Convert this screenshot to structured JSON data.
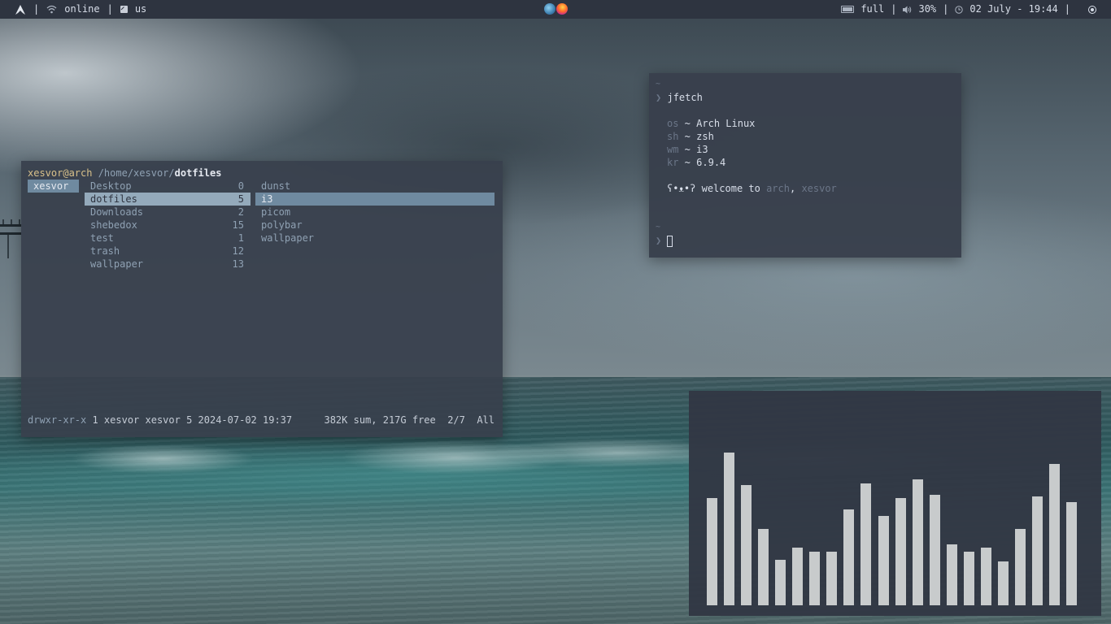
{
  "topbar": {
    "left": {
      "logo_icon": "arch-logo-icon",
      "separator": "|",
      "network_icon": "wifi-icon",
      "network_status": "online",
      "keyboard_icon": "keyboard-icon",
      "keyboard_layout": "us"
    },
    "center": {
      "apps": [
        "globe-app-icon",
        "firefox-app-icon"
      ]
    },
    "right": {
      "battery_icon": "battery-icon",
      "battery_status": "full",
      "volume_icon": "volume-icon",
      "volume_level": "30%",
      "clock_icon": "clock-icon",
      "datetime": "02 July - 19:44",
      "power_icon": "power-icon"
    }
  },
  "file_manager": {
    "header": {
      "user_host": "xesvor@arch",
      "path": " /home/xesvor/",
      "current_dir": "dotfiles"
    },
    "parent_column": [
      {
        "name": "xesvor",
        "selected": true
      }
    ],
    "current_column": [
      {
        "name": "Desktop",
        "count": "0"
      },
      {
        "name": "dotfiles",
        "count": "5",
        "selected": true
      },
      {
        "name": "Downloads",
        "count": "2"
      },
      {
        "name": "shebedox",
        "count": "15"
      },
      {
        "name": "test",
        "count": "1"
      },
      {
        "name": "trash",
        "count": "12"
      },
      {
        "name": "wallpaper",
        "count": "13"
      }
    ],
    "preview_column": [
      {
        "name": "dunst"
      },
      {
        "name": "i3",
        "selected": true
      },
      {
        "name": "picom"
      },
      {
        "name": "polybar"
      },
      {
        "name": "wallpaper"
      }
    ],
    "status": {
      "permissions": "drwxr-xr-x",
      "details": " 1 xesvor xesvor 5 2024-07-02 19:37",
      "summary": "382K sum, 217G free  2/7  All"
    }
  },
  "terminal": {
    "tilde1": "~",
    "prompt_symbol": "❯",
    "command": "jfetch",
    "info": [
      {
        "key": "os",
        "sep": " ~ ",
        "value": "Arch Linux"
      },
      {
        "key": "sh",
        "sep": " ~ ",
        "value": "zsh"
      },
      {
        "key": "wm",
        "sep": " ~ ",
        "value": "i3"
      },
      {
        "key": "kr",
        "sep": " ~ ",
        "value": "6.9.4"
      }
    ],
    "welcome": {
      "face": "ʕ•ᴥ•ʔ",
      "text": " welcome to ",
      "host": "arch",
      "comma": ", ",
      "user": "xesvor"
    },
    "tilde2": "~"
  },
  "visualizer": {
    "bar_color": "#c8cbcc",
    "levels": [
      0.56,
      0.8,
      0.63,
      0.4,
      0.24,
      0.3,
      0.28,
      0.28,
      0.5,
      0.64,
      0.47,
      0.56,
      0.66,
      0.58,
      0.32,
      0.28,
      0.3,
      0.23,
      0.4,
      0.57,
      0.74,
      0.54
    ]
  },
  "colors": {
    "bar_bg": "#2e3440",
    "window_bg": "#383f4c",
    "selection": "#94aabb",
    "user_accent": "#d8c08a",
    "dim_text": "#6b7688"
  }
}
